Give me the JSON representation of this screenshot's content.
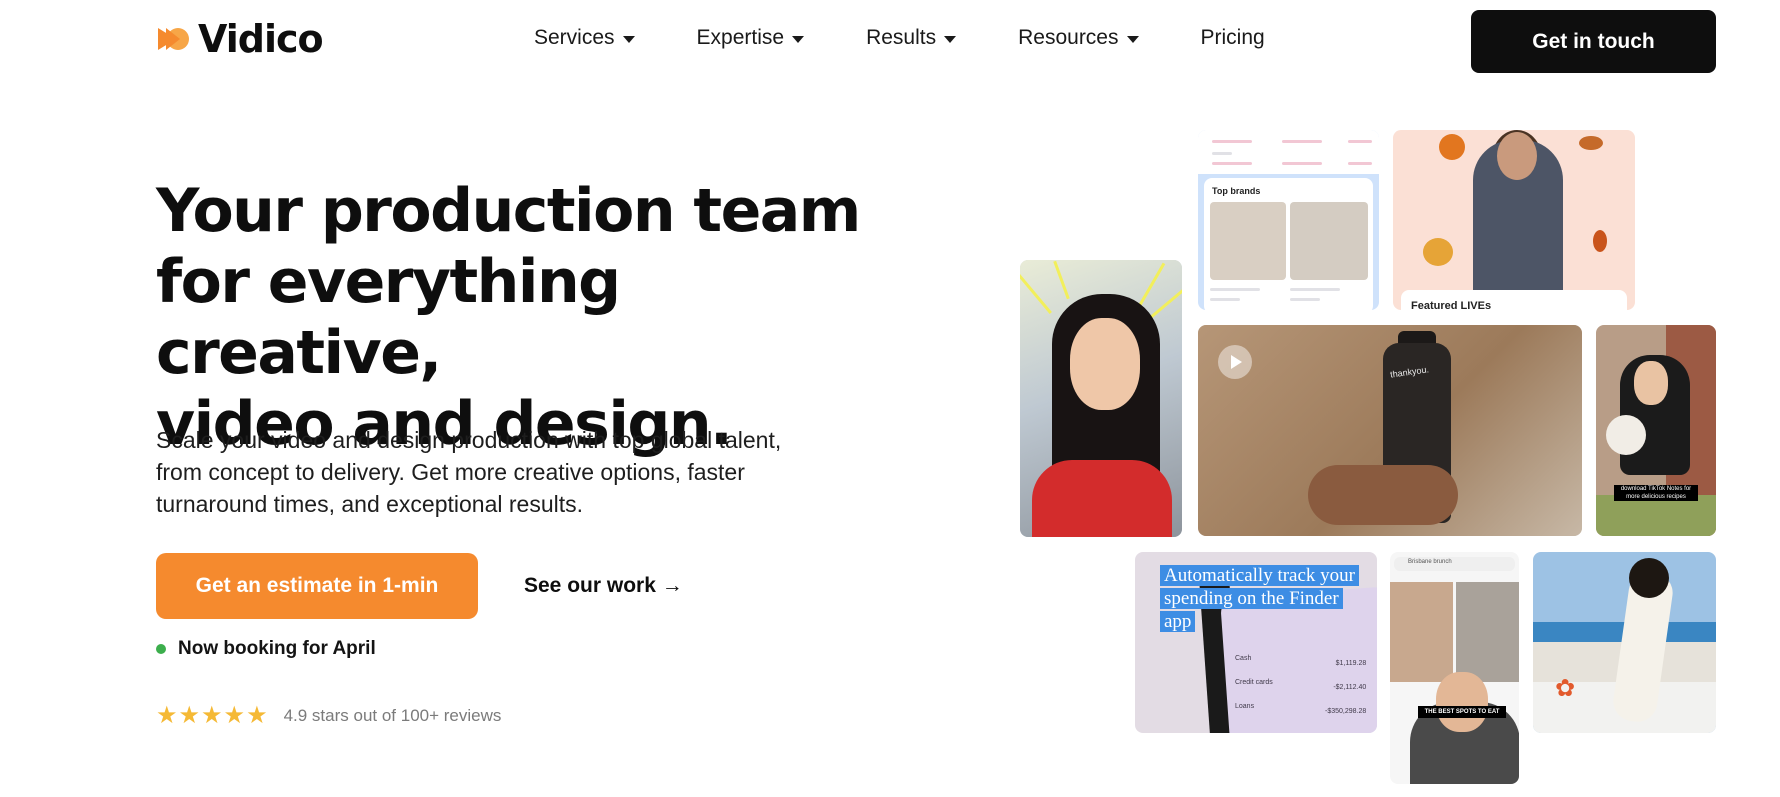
{
  "brand": {
    "name": "Vidico",
    "mark_colors": [
      "#f58a2e",
      "#f7b04d"
    ]
  },
  "nav": {
    "items": [
      {
        "label": "Services",
        "has_dropdown": true
      },
      {
        "label": "Expertise",
        "has_dropdown": true
      },
      {
        "label": "Results",
        "has_dropdown": true
      },
      {
        "label": "Resources",
        "has_dropdown": true
      },
      {
        "label": "Pricing",
        "has_dropdown": false
      }
    ],
    "cta_label": "Get in touch"
  },
  "hero": {
    "title_line_1": "Your production team",
    "title_line_2": "for everything creative,",
    "title_line_3": "video and design.",
    "subtitle_line_1": "Scale your video and design production with top global talent,",
    "subtitle_line_2": "from concept to delivery. Get more creative options, faster",
    "subtitle_line_3": "turnaround times, and exceptional results.",
    "primary_button": "Get an estimate in 1-min",
    "secondary_link": "See our work →",
    "booking_status": "Now booking for April",
    "rating": {
      "stars": 5,
      "text": "4.9 stars out of 100+ reviews"
    }
  },
  "collage": {
    "brands_tile_label": "Top brands",
    "lives_tile_label": "Featured LIVEs",
    "bottle_label": "thankyou.",
    "tiktok_caption": "download TikTok Notes for more delicious recipes",
    "finder_caption": "Automatically track your spending on the Finder app",
    "finder_rows": [
      "Cash",
      "Credit cards",
      "Loans"
    ],
    "finder_values": [
      "$1,119.28",
      "-$2,112.40",
      "-$350,298.28"
    ],
    "food_tag": "THE BEST SPOTS TO EAT",
    "food_search": "Brisbane brunch"
  },
  "colors": {
    "accent_orange": "#f58a2e",
    "dark": "#0e0e0e",
    "booking_green": "#3cae4c",
    "star_yellow": "#f5b935"
  }
}
